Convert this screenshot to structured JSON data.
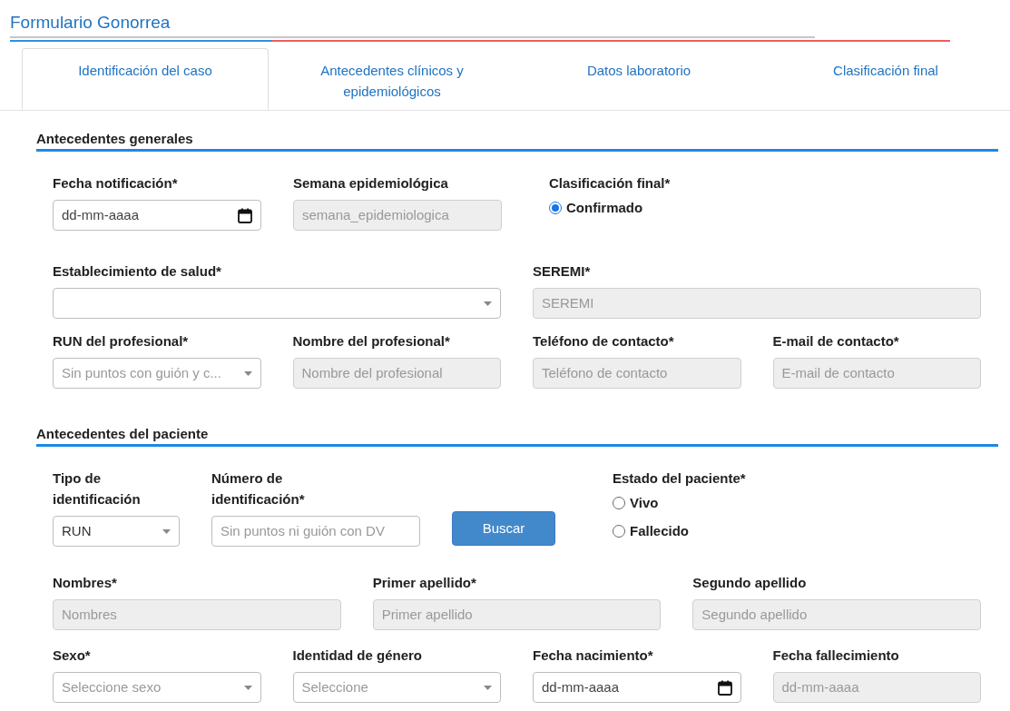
{
  "title": "Formulario Gonorrea",
  "tabs": [
    {
      "label": "Identificación del caso",
      "selected": true
    },
    {
      "label": "Antecedentes clínicos y epidemiológicos",
      "selected": false
    },
    {
      "label": "Datos laboratorio",
      "selected": false
    },
    {
      "label": "Clasificación final",
      "selected": false
    }
  ],
  "sections": [
    {
      "heading": "Antecedentes generales",
      "rows": [
        {
          "fields": [
            {
              "kind": "date",
              "label": "Fecha notificación*",
              "value": "dd-mm-aaaa",
              "disabled": false
            },
            {
              "kind": "text",
              "label": "Semana epidemiológica",
              "placeholder": "semana_epidemiologica",
              "disabled": true
            },
            {
              "kind": "radio",
              "label": "Clasificación final*",
              "options": [
                {
                  "label": "Confirmado",
                  "selected": true
                }
              ]
            }
          ]
        },
        {
          "fields": [
            {
              "kind": "select",
              "label": "Establecimiento de salud*"
            },
            {
              "kind": "text",
              "label": "SEREMI*",
              "placeholder": "SEREMI",
              "disabled": true
            }
          ]
        },
        {
          "fields": [
            {
              "kind": "select",
              "label": "RUN del profesional*",
              "placeholder": "Sin puntos con guión y c..."
            },
            {
              "kind": "text",
              "label": "Nombre del profesional*",
              "placeholder": "Nombre del profesional",
              "disabled": true
            },
            {
              "kind": "text",
              "label": "Teléfono de contacto*",
              "placeholder": "Teléfono de contacto",
              "disabled": true
            },
            {
              "kind": "text",
              "label": "E-mail de contacto*",
              "placeholder": "E-mail de contacto",
              "disabled": true
            }
          ]
        }
      ]
    },
    {
      "heading": "Antecedentes del paciente",
      "rows": [
        {
          "fields": [
            {
              "kind": "select",
              "label": "Tipo de identificación",
              "value": "RUN"
            },
            {
              "kind": "text",
              "label": "Número de identificación*",
              "placeholder": "Sin puntos ni guión con DV",
              "disabled": false
            },
            {
              "kind": "button",
              "label": "Buscar"
            },
            {
              "kind": "radio",
              "label": "Estado del paciente*",
              "options": [
                {
                  "label": "Vivo",
                  "selected": false
                },
                {
                  "label": "Fallecido",
                  "selected": false
                }
              ]
            }
          ]
        },
        {
          "fields": [
            {
              "kind": "text",
              "label": "Nombres*",
              "placeholder": "Nombres",
              "disabled": true
            },
            {
              "kind": "text",
              "label": "Primer apellido*",
              "placeholder": "Primer apellido",
              "disabled": true
            },
            {
              "kind": "text",
              "label": "Segundo apellido",
              "placeholder": "Segundo apellido",
              "disabled": true
            }
          ]
        },
        {
          "fields": [
            {
              "kind": "select",
              "label": "Sexo*",
              "placeholder": "Seleccione sexo"
            },
            {
              "kind": "select",
              "label": "Identidad de género",
              "placeholder": "Seleccione"
            },
            {
              "kind": "date",
              "label": "Fecha nacimiento*",
              "value": "dd-mm-aaaa",
              "disabled": false
            },
            {
              "kind": "date",
              "label": "Fecha fallecimiento",
              "placeholder": "dd-mm-aaaa",
              "disabled": true
            }
          ]
        }
      ]
    }
  ]
}
